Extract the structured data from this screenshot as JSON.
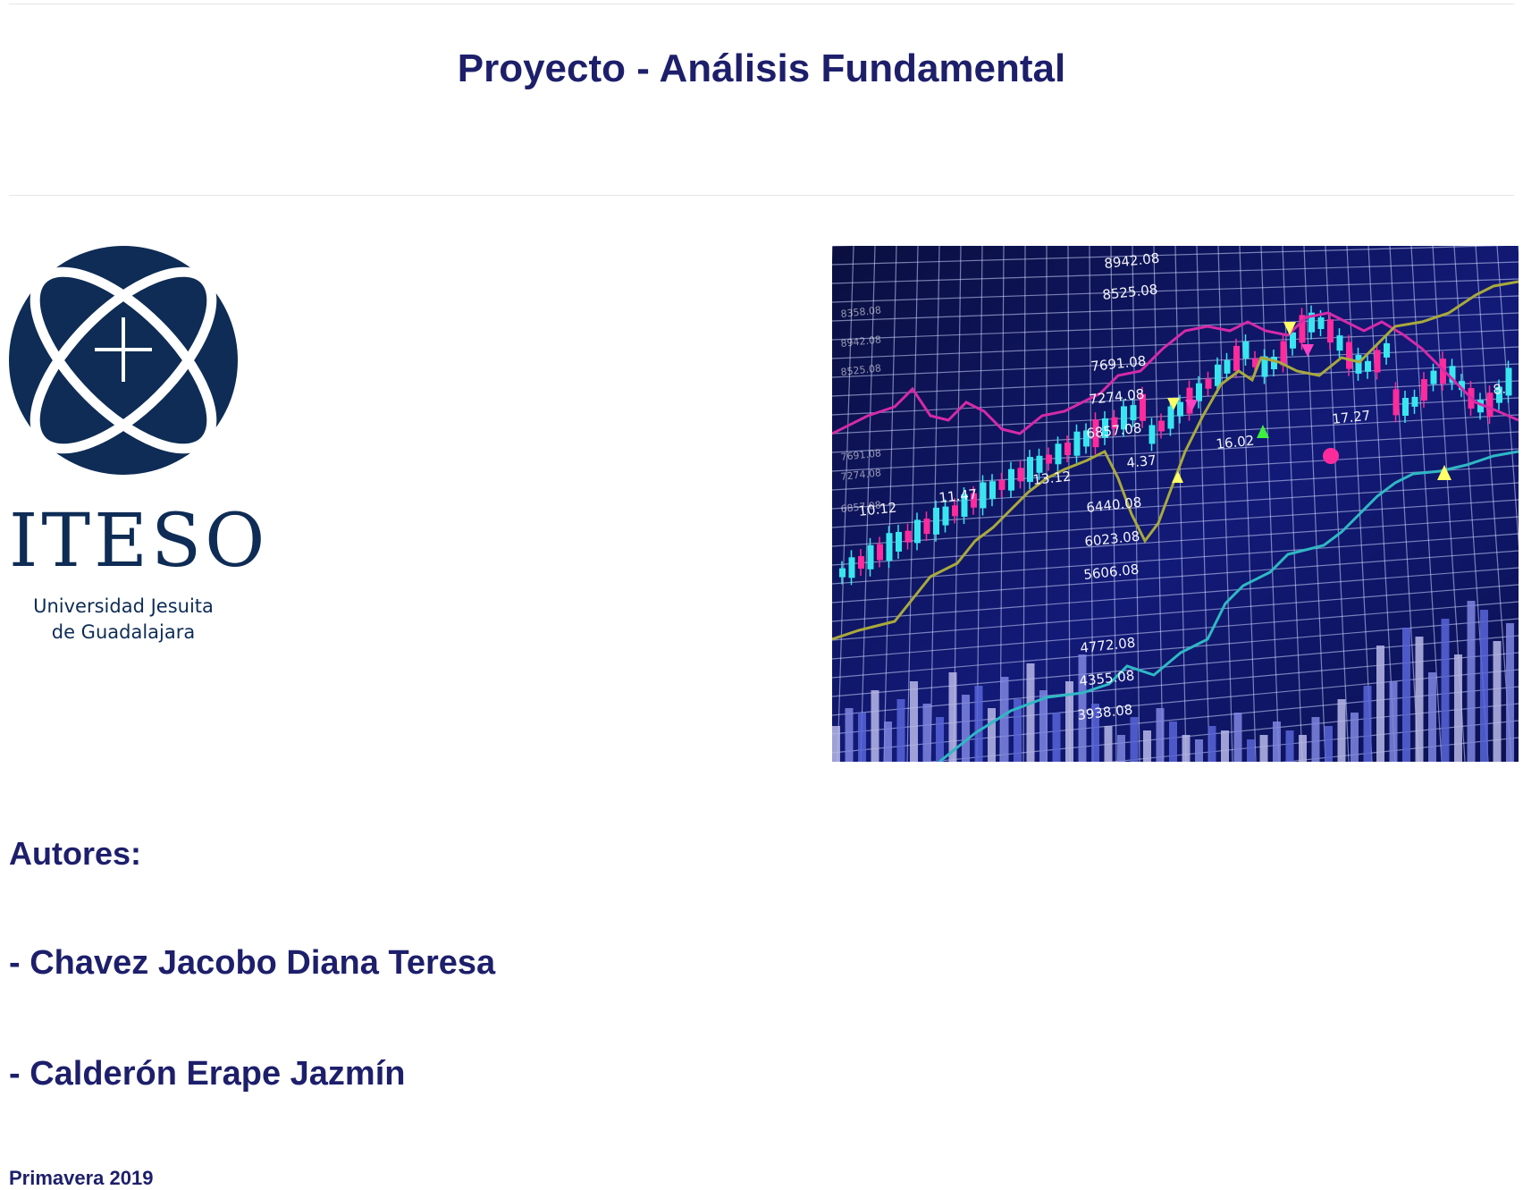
{
  "document": {
    "title": "Proyecto - Análisis Fundamental",
    "authors_label": "Autores:",
    "authors": [
      "- Chavez Jacobo Diana Teresa",
      "- Calderón Erape Jazmín"
    ],
    "term": "Primavera 2019"
  },
  "logo": {
    "name": "ITESO",
    "subtitle_line1": "Universidad Jesuita",
    "subtitle_line2": "de Guadalajara",
    "color": "#0e2c55"
  },
  "stock_image": {
    "labels": [
      "8942.08",
      "8525.08",
      "7691.08",
      "7274.08",
      "6857.08",
      "6440.08",
      "6023.08",
      "5606.08",
      "4772.08",
      "4355.08",
      "3938.08",
      "4.37",
      "11.47",
      "10.12",
      "13.12",
      "16.02",
      "17.27",
      "8.",
      "8358.08",
      "8942.08",
      "8525.08",
      "7691.08",
      "7274.08",
      "6857.08"
    ],
    "colors": {
      "background": "#0b1150",
      "grid": "#cfd8ff",
      "magenta": "#d52aa8",
      "olive": "#a9a93c",
      "cyan": "#2fb8c4",
      "candle_up": "#39e6f0",
      "candle_down": "#ff2b9c"
    }
  },
  "colors": {
    "text": "#1d1f6b",
    "rule": "#e6e6e6"
  }
}
